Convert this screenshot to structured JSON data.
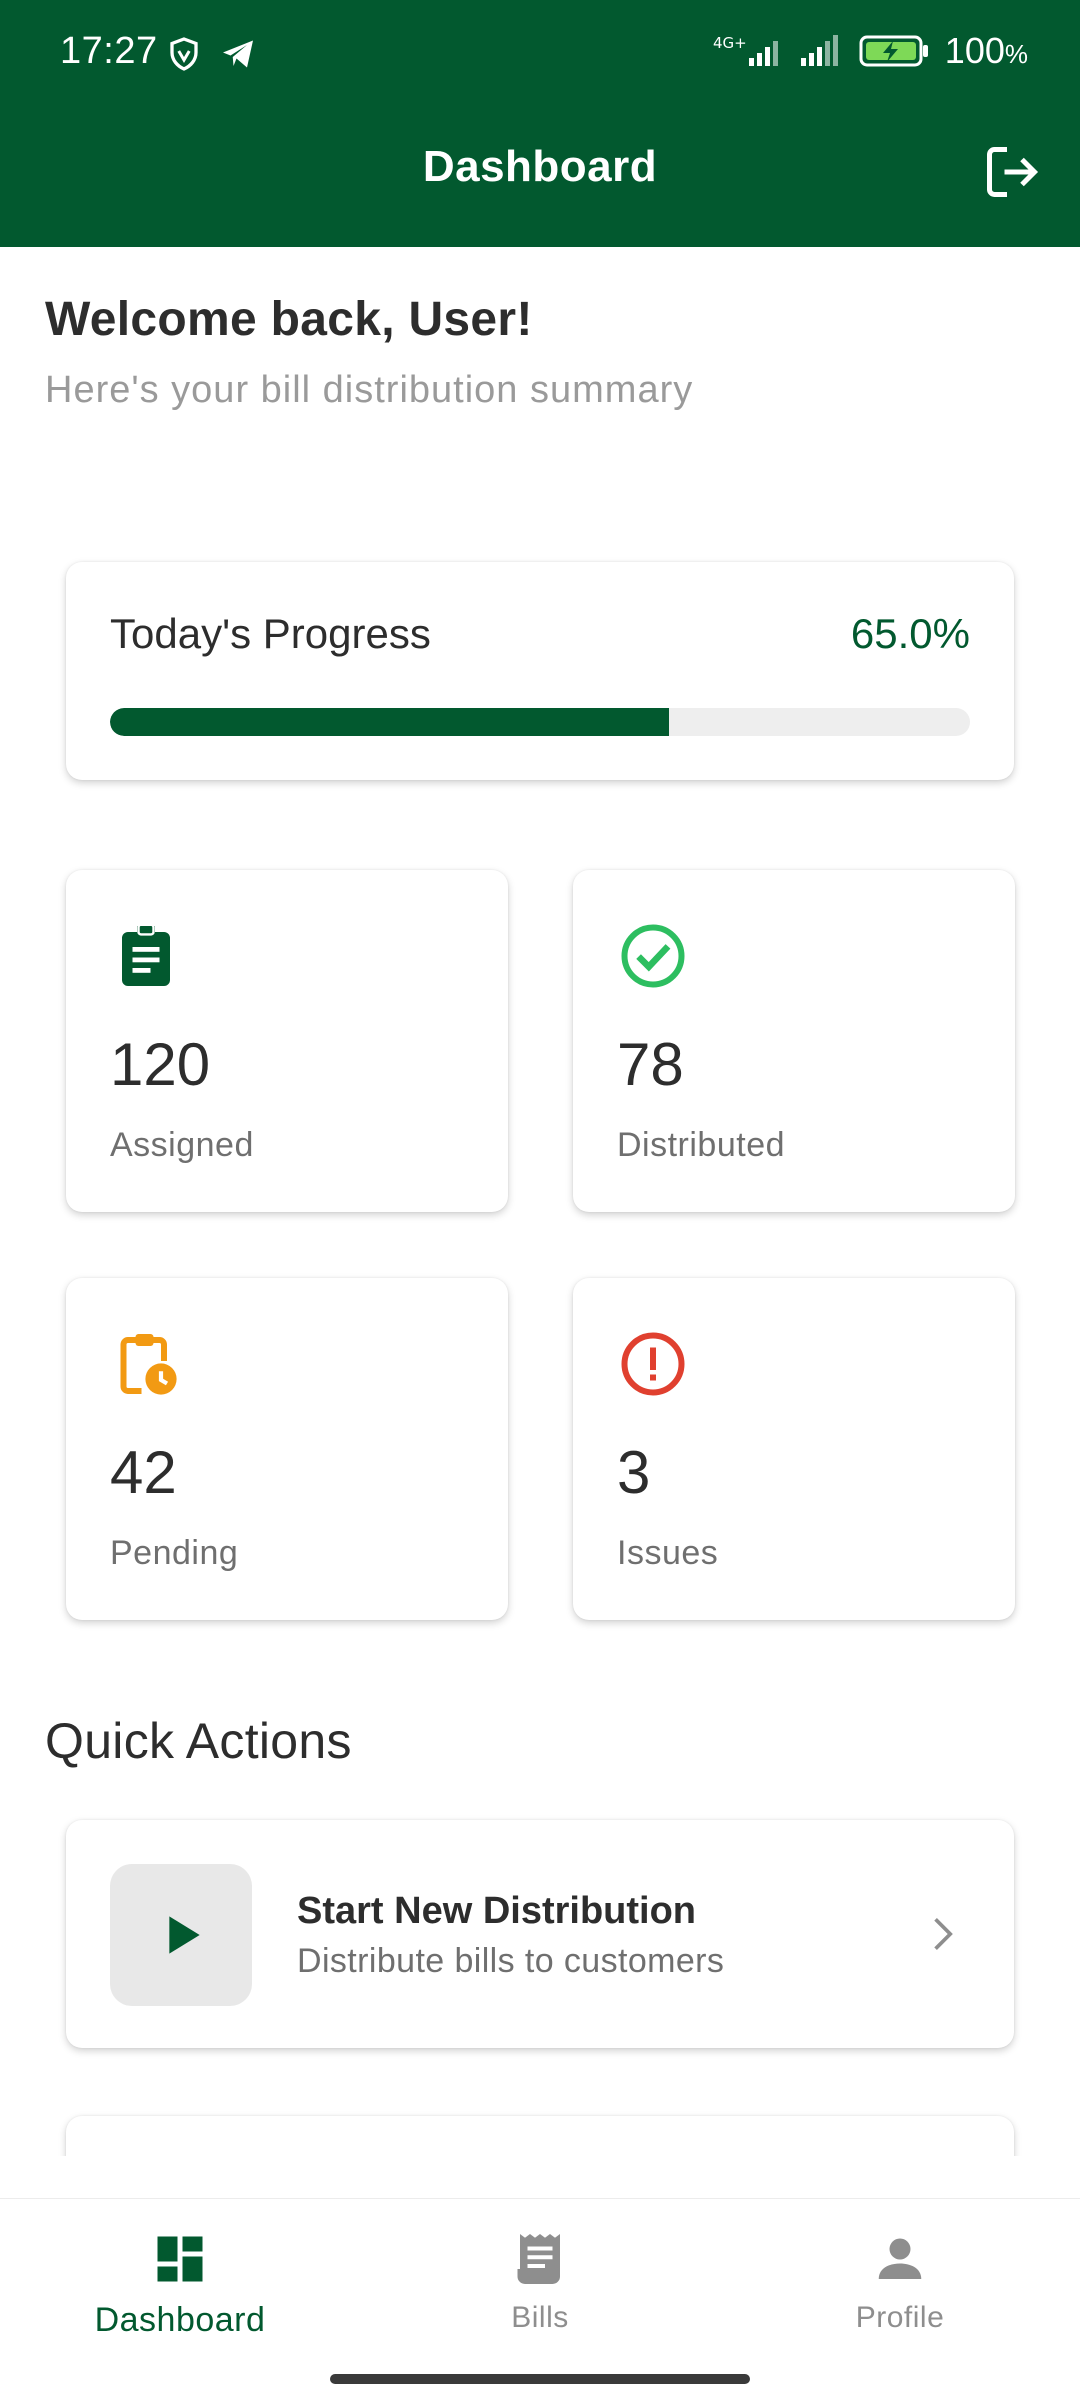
{
  "status_bar": {
    "time": "17:27",
    "network": "4G+",
    "battery": "100",
    "battery_unit": "%"
  },
  "header": {
    "title": "Dashboard"
  },
  "welcome": {
    "heading": "Welcome back, User!",
    "subtitle": "Here's your bill distribution summary"
  },
  "progress": {
    "label": "Today's Progress",
    "percent_text": "65.0%",
    "value": 0.65
  },
  "stats": [
    {
      "value": "120",
      "label": "Assigned",
      "icon": "clipboard-icon",
      "color": "#02592F"
    },
    {
      "value": "78",
      "label": "Distributed",
      "icon": "check-circle-icon",
      "color": "#2DBE60"
    },
    {
      "value": "42",
      "label": "Pending",
      "icon": "clipboard-clock-icon",
      "color": "#F29A13"
    },
    {
      "value": "3",
      "label": "Issues",
      "icon": "error-circle-icon",
      "color": "#E0402F"
    }
  ],
  "quick_actions": {
    "title": "Quick Actions",
    "items": [
      {
        "title": "Start New Distribution",
        "subtitle": "Distribute bills to customers",
        "icon": "play-icon"
      }
    ]
  },
  "bottom_nav": {
    "items": [
      {
        "label": "Dashboard",
        "icon": "dashboard-icon",
        "active": true
      },
      {
        "label": "Bills",
        "icon": "receipt-icon",
        "active": false
      },
      {
        "label": "Profile",
        "icon": "person-icon",
        "active": false
      }
    ]
  },
  "colors": {
    "primary": "#02592F",
    "success": "#2DBE60",
    "warning": "#F29A13",
    "danger": "#E0402F",
    "muted": "#8E8E8E"
  }
}
